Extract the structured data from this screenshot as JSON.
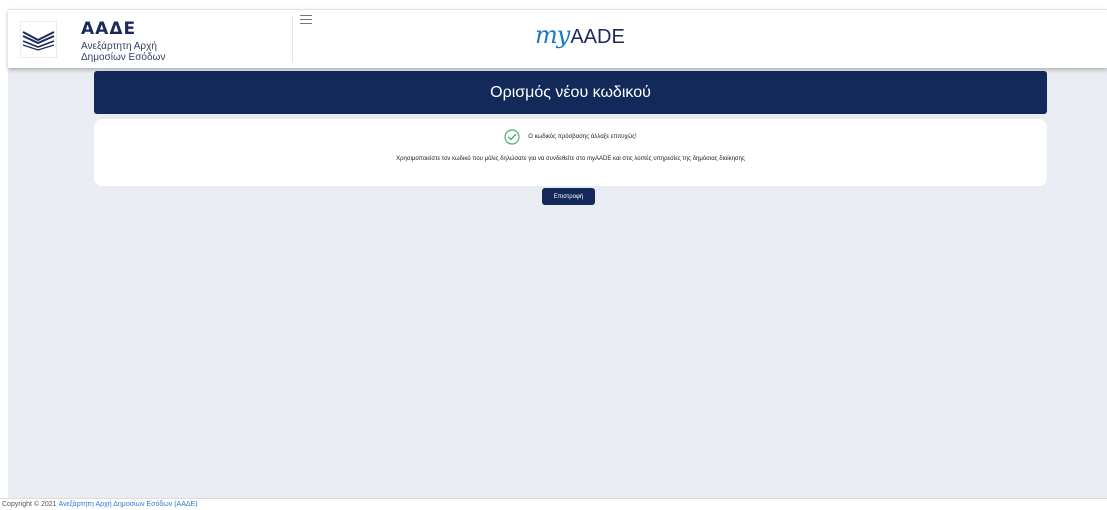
{
  "header": {
    "brand_title": "ΑΑΔΕ",
    "brand_sub_line1": "Ανεξάρτητη Αρχή",
    "brand_sub_line2": "Δημοσίων Εσόδων",
    "app_logo_my": "my",
    "app_logo_aade": "AADE",
    "logo_icon": "aade-emblem-icon",
    "menu_icon": "hamburger-menu-icon"
  },
  "main": {
    "page_title": "Ορισμός νέου κωδικού",
    "success_icon": "check-circle-icon",
    "success_message": "Ο κωδικός πρόσβασης άλλαξε επιτυχώς!",
    "info_message": "Χρησιμοποιείστε τον κωδικό που μόλις δηλώσατε για να συνδεθείτε στο myAADE και στις λοιπές υπηρεσίες της δημόσιας διοίκησης",
    "back_button_label": "Επιστροφή"
  },
  "footer": {
    "copyright": "Copyright © 2021",
    "link_text": "Ανεξάρτητη Αρχή Δημοσίων Εσόδων (ΑΑΔΕ)"
  },
  "colors": {
    "navy": "#13295a",
    "accent_blue": "#1a78c8",
    "success_green": "#4caf7a",
    "background": "#eaecf3"
  }
}
